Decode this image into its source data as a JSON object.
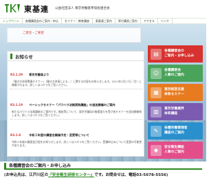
{
  "header": {
    "brand": "東基連",
    "org_name": "公益社団法人 東京労働基準協会連合会"
  },
  "nav": {
    "items": [
      "トップページ",
      "各種講習会のご案内・申込",
      "セミナー・教育講座",
      "東基連ご案内",
      "寄付講習ご案内",
      "アクセス",
      "リンク"
    ]
  },
  "banner": {
    "text": "ご意見・ご要望"
  },
  "news": {
    "heading": "お知らせ",
    "items": [
      {
        "date": "R3.1.29",
        "title": "東京労働局より",
        "body": "「働き方改革関連セミナー」（働き方改革による…）に関する内容をお知らせします。2021年3月17日（月）に開催されます。詳しくはコチラをご覧ください。"
      },
      {
        "date": "R3.1.19",
        "title": "ベーシックセミナー「パワハラ法務実践講座」の追加開催のご案内",
        "body": "新たなパワハラ法務講座のご案内です。福祉等について、東京労働局の後援協力を受け各セミナーを追加開催致します。詳しくはコチラをご覧ください。"
      },
      {
        "date": "R3.1.8",
        "title": "令和２年度の講習会開催予定・変更等について",
        "body": "令和２年度の講習会日程をお知らせします。詳しくはコチラをご覧ください。受講申込みについて変更の可能性があります。"
      }
    ]
  },
  "sidebar": {
    "buttons": [
      {
        "label": "各種講習会の\nご案内・お申し込み",
        "color": "#d7322f",
        "icon": "book-icon"
      },
      {
        "label": "各種講習会\n人事のご案内",
        "color": "#4aa35a",
        "icon": "people-icon"
      },
      {
        "label": "東京経営支援\n体系セミナー",
        "color": "#e87a1f",
        "icon": "calendar-icon"
      },
      {
        "label": "東京労働業界\n体系講座",
        "color": "#7a5bb0",
        "icon": "chart-icon"
      },
      {
        "label": "各種労働管理者\n講座のご案内",
        "color": "#2a8fcd",
        "icon": "pencil-icon"
      },
      {
        "label": "安全衛生講座\n人事のご案内",
        "color": "#e34e8a",
        "icon": "shield-icon"
      }
    ]
  },
  "contact": {
    "heading": "各種講習会のご案内・お申し込み",
    "prefix": "(お申込先は、江戸川区の",
    "link": "『安全衛生研修センター』",
    "suffix": "です。お問合せは、電話03-5678-5556)"
  }
}
